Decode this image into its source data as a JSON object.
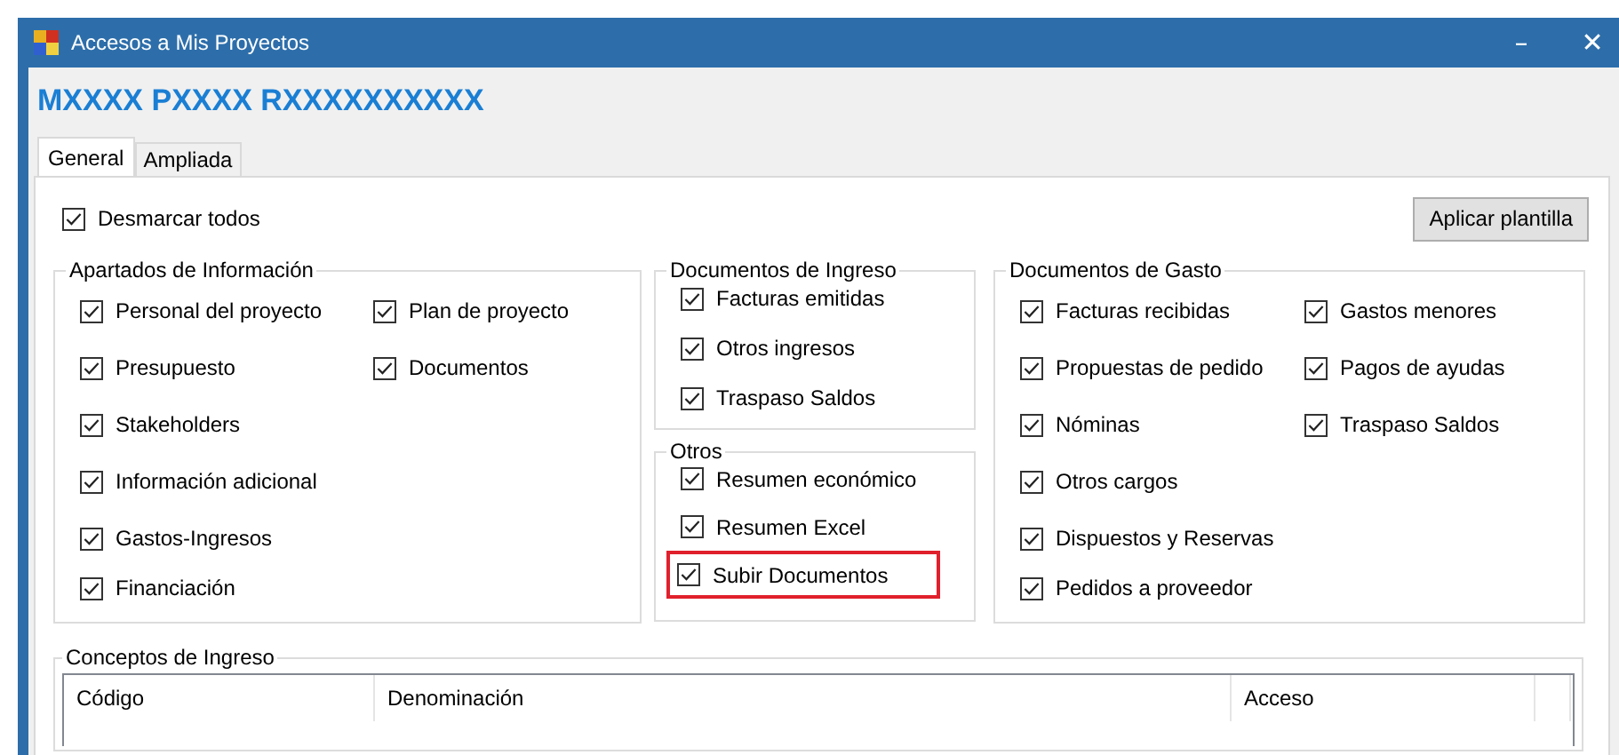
{
  "window": {
    "title": "Accesos a Mis Proyectos",
    "controls": [
      "–",
      "✕"
    ]
  },
  "project_name": "MXXXX PXXXX RXXXXXXXXXX",
  "tabs": [
    {
      "label": "General",
      "selected": true
    },
    {
      "label": "Ampliada",
      "selected": false
    }
  ],
  "toggle_all": {
    "label": "Desmarcar todos",
    "checked": true
  },
  "apply_button": "Aplicar plantilla",
  "groups": [
    {
      "title": "Apartados de Información",
      "columns": [
        [
          {
            "label": "Personal del proyecto",
            "checked": true,
            "highlighted": false
          },
          {
            "label": "Presupuesto",
            "checked": true,
            "highlighted": false
          },
          {
            "label": "Stakeholders",
            "checked": true,
            "highlighted": false
          },
          {
            "label": "Información adicional",
            "checked": true,
            "highlighted": false
          },
          {
            "label": "Gastos-Ingresos",
            "checked": true,
            "highlighted": false
          },
          {
            "label": "Financiación",
            "checked": true,
            "highlighted": false
          }
        ],
        [
          {
            "label": "Plan de proyecto",
            "checked": true,
            "highlighted": false
          },
          {
            "label": "Documentos",
            "checked": true,
            "highlighted": false
          }
        ]
      ]
    },
    {
      "title": "Documentos de Ingreso",
      "columns": [
        [
          {
            "label": "Facturas emitidas",
            "checked": true,
            "highlighted": false
          },
          {
            "label": "Otros ingresos",
            "checked": true,
            "highlighted": false
          },
          {
            "label": "Traspaso Saldos",
            "checked": true,
            "highlighted": false
          }
        ]
      ]
    },
    {
      "title": "Otros",
      "columns": [
        [
          {
            "label": "Resumen económico",
            "checked": true,
            "highlighted": false
          },
          {
            "label": "Resumen Excel",
            "checked": true,
            "highlighted": false
          },
          {
            "label": "Subir Documentos",
            "checked": true,
            "highlighted": true
          }
        ]
      ]
    },
    {
      "title": "Documentos de Gasto",
      "columns": [
        [
          {
            "label": "Facturas recibidas",
            "checked": true,
            "highlighted": false
          },
          {
            "label": "Propuestas de pedido",
            "checked": true,
            "highlighted": false
          },
          {
            "label": "Nóminas",
            "checked": true,
            "highlighted": false
          },
          {
            "label": "Otros cargos",
            "checked": true,
            "highlighted": false
          },
          {
            "label": "Dispuestos y Reservas",
            "checked": true,
            "highlighted": false
          },
          {
            "label": "Pedidos a proveedor",
            "checked": true,
            "highlighted": false
          }
        ],
        [
          {
            "label": "Gastos menores",
            "checked": true,
            "highlighted": false
          },
          {
            "label": "Pagos de ayudas",
            "checked": true,
            "highlighted": false
          },
          {
            "label": "Traspaso Saldos",
            "checked": true,
            "highlighted": false
          }
        ]
      ]
    }
  ],
  "income_concepts": {
    "title": "Conceptos de Ingreso",
    "table": {
      "columns": [
        "Código",
        "Denominación",
        "Acceso"
      ]
    }
  }
}
